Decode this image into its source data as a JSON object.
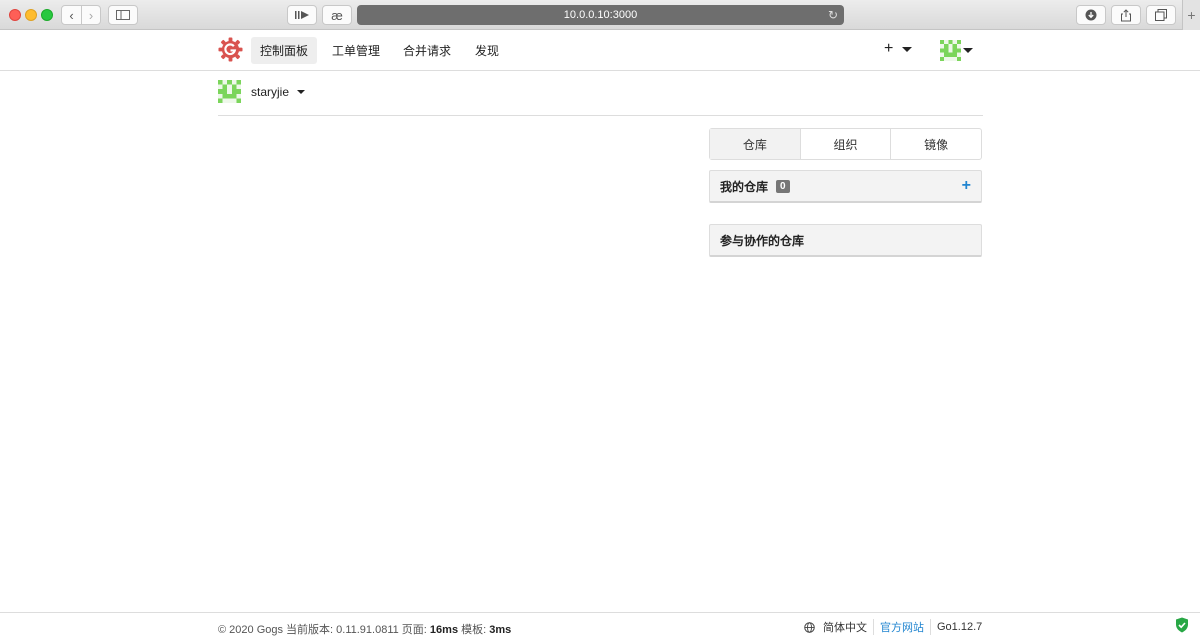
{
  "browser": {
    "url": "10.0.0.10:3000"
  },
  "header": {
    "menu": [
      "控制面板",
      "工单管理",
      "合并请求",
      "发现"
    ],
    "plus_label": "+"
  },
  "context": {
    "username": "staryjie"
  },
  "tabs": [
    "仓库",
    "组织",
    "镜像"
  ],
  "panels": {
    "my_repos": {
      "title": "我的仓库",
      "count": "0"
    },
    "collab_repos": {
      "title": "参与协作的仓库"
    }
  },
  "footer": {
    "copyright": "© 2020 Gogs 当前版本: 0.11.91.0811 页面: ",
    "page_time": "16ms",
    "template_label": " 模板: ",
    "template_time": "3ms",
    "language": "简体中文",
    "website": "官方网站",
    "go_version": "Go1.12.7"
  },
  "colors": {
    "logo": "#d9534f",
    "accent": "#2185d0",
    "avatar": "#7bd55b"
  }
}
